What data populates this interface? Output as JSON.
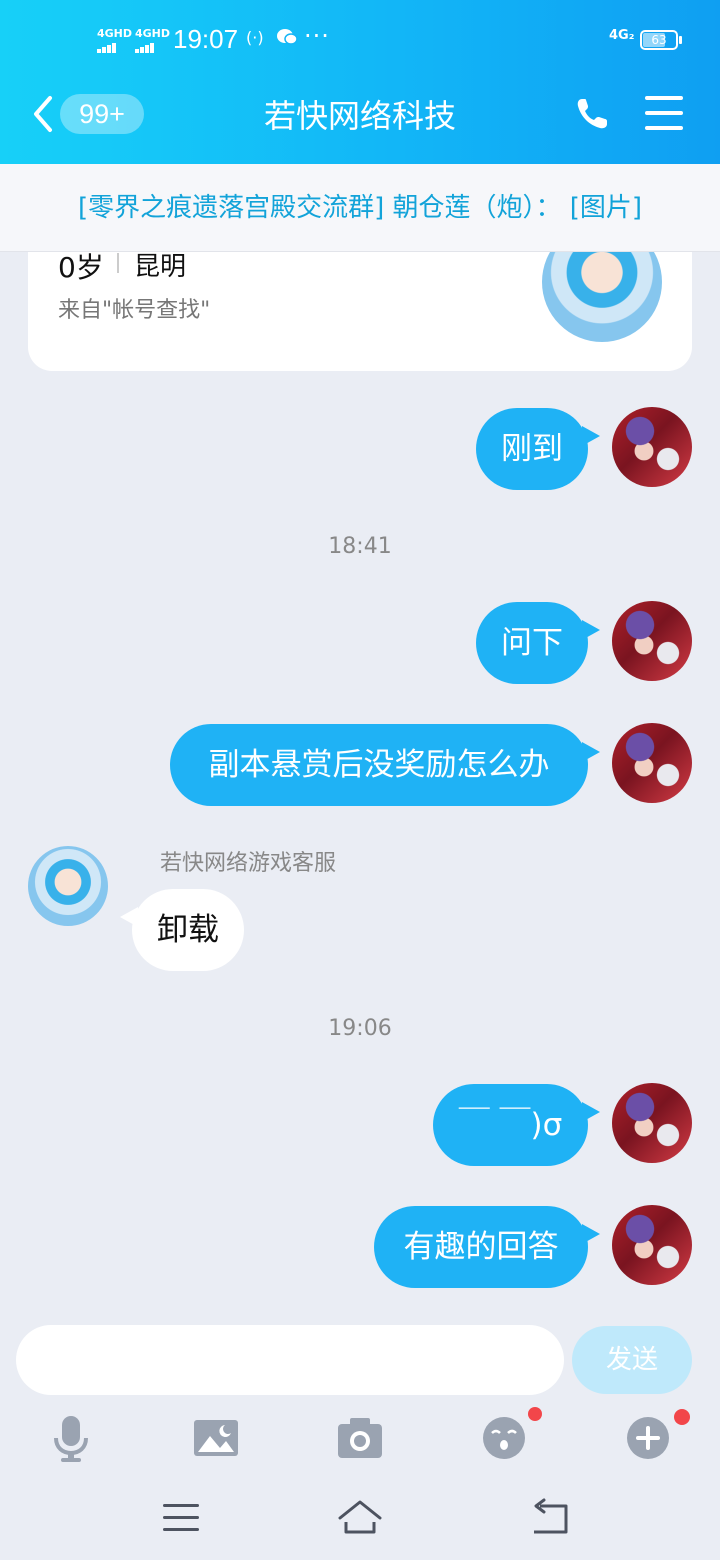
{
  "status_bar": {
    "signal1": "4GHD",
    "signal2": "4GHD",
    "time": "19:07",
    "more": "···",
    "network": "4G₂",
    "battery": "63"
  },
  "header": {
    "unread_count": "99+",
    "title": "若快网络科技"
  },
  "notice": {
    "text": "[零界之痕遗落宫殿交流群] 朝仓莲（炮）：  [图片]"
  },
  "profile": {
    "age": "0岁",
    "city": "昆明",
    "source": "来自\"帐号查找\""
  },
  "messages": [
    {
      "text": "刚到"
    },
    {
      "time": "18:41"
    },
    {
      "text": "问下"
    },
    {
      "text": "副本悬赏后没奖励怎么办"
    },
    {
      "sender": "若快网络游戏客服",
      "text": "卸载"
    },
    {
      "time": "19:06"
    },
    {
      "text": "￣ ￣)σ"
    },
    {
      "text": "有趣的回答"
    }
  ],
  "input": {
    "value": "",
    "send_label": "发送"
  },
  "colors": {
    "header_start": "#17d0f8",
    "header_end": "#0f9ff2",
    "outgoing_bubble": "#1fb2f5",
    "notice_text": "#12a3d9",
    "badge_dot": "#f2464a"
  },
  "icons": [
    "back-arrow-icon",
    "phone-icon",
    "menu-icon",
    "microphone-icon",
    "image-icon",
    "camera-icon",
    "emoji-icon",
    "plus-icon",
    "nav-menu-icon",
    "nav-home-icon",
    "nav-back-icon"
  ]
}
